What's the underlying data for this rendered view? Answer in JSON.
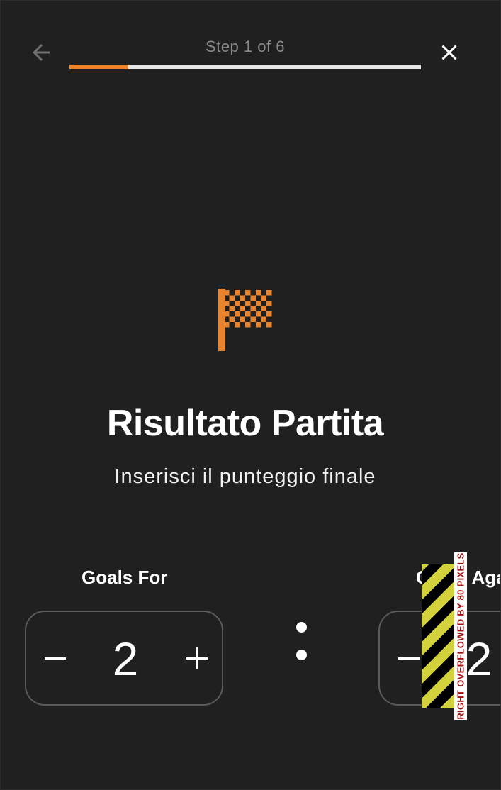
{
  "header": {
    "step_label": "Step 1 of 6",
    "progress_fraction": 0.1667,
    "back_icon": "arrow-left-icon",
    "close_icon": "close-icon"
  },
  "hero": {
    "icon": "checkered-flag-icon",
    "title": "Risultato Partita",
    "subtitle": "Inserisci il punteggio finale"
  },
  "score": {
    "goals_for": {
      "label": "Goals For",
      "value": "2",
      "minus_icon": "minus-icon",
      "plus_icon": "plus-icon"
    },
    "separator": ":",
    "goals_against": {
      "label": "Goals Against",
      "value": "2",
      "minus_icon": "minus-icon"
    }
  },
  "debug": {
    "overflow_text": "RIGHT OVERFLOWED BY 80 PIXELS"
  },
  "colors": {
    "accent": "#e8832e",
    "background": "#202020",
    "progress_track": "#e6e6e6",
    "muted_text": "#8a8a8a",
    "overflow_yellow": "#d4d23c",
    "overflow_red": "#a01010"
  }
}
